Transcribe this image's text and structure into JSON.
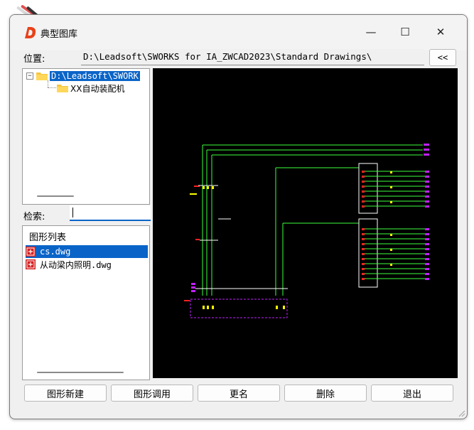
{
  "window": {
    "title": "典型图库",
    "controls": {
      "minimize": "—",
      "maximize": "☐",
      "close": "✕"
    }
  },
  "location": {
    "label": "位置:",
    "path": "D:\\Leadsoft\\SWORKS for IA_ZWCAD2023\\Standard Drawings\\",
    "collapse_label": "<<"
  },
  "tree": {
    "root": {
      "label": "D:\\Leadsoft\\SWORK",
      "expander": "−"
    },
    "children": [
      {
        "label": "XX自动装配机"
      }
    ]
  },
  "search": {
    "label": "检索:",
    "value": ""
  },
  "file_list": {
    "header": "图形列表",
    "items": [
      {
        "name": "cs.dwg",
        "selected": true
      },
      {
        "name": "从动梁内照明.dwg",
        "selected": false
      }
    ]
  },
  "buttons": {
    "new": "图形新建",
    "call": "图形调用",
    "rename": "更名",
    "delete": "删除",
    "exit": "退出"
  },
  "icons": {
    "app": "app-d-logo-icon",
    "folder": "folder-icon",
    "file": "dwg-file-icon"
  },
  "colors": {
    "accent": "#0a64c8",
    "preview_bg": "#000000",
    "wire": "#3cff3c",
    "label_magenta": "#c020ff",
    "label_yellow": "#ffff00",
    "label_red": "#ff2020",
    "app_icon": "#e8421a"
  }
}
